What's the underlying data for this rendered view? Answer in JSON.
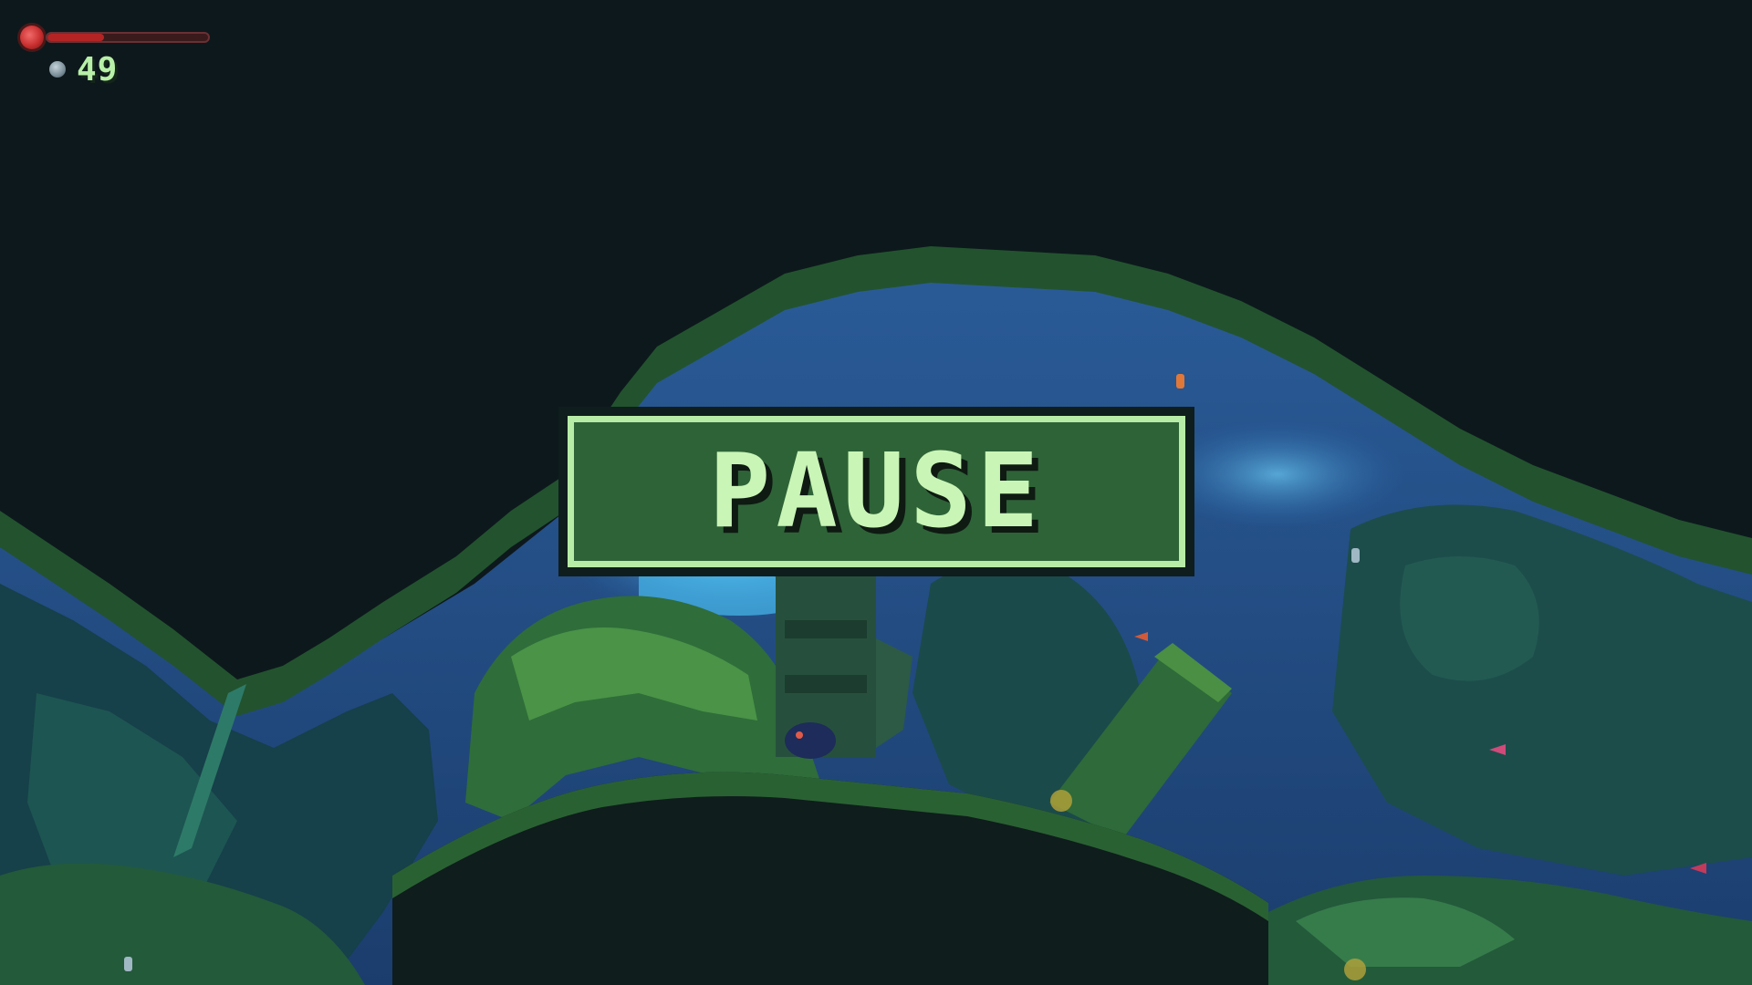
{
  "hud": {
    "health_fraction": 0.35,
    "health_icon": "heart-orb-icon",
    "currency_icon": "coin-icon",
    "currency_count": "49"
  },
  "pause_menu": {
    "title": "PAUSE"
  },
  "colors": {
    "sky_dark": "#0d181c",
    "water_blue": "#1f4d86",
    "water_light": "#3c8fd1",
    "foliage_dark": "#1e4a2c",
    "foliage_mid": "#2f6d3a",
    "foliage_light": "#4f9a4a",
    "panel_fill": "#2e6337",
    "panel_border": "#b7eca6",
    "text_accent": "#c9f5b6",
    "health_red": "#b52424"
  }
}
